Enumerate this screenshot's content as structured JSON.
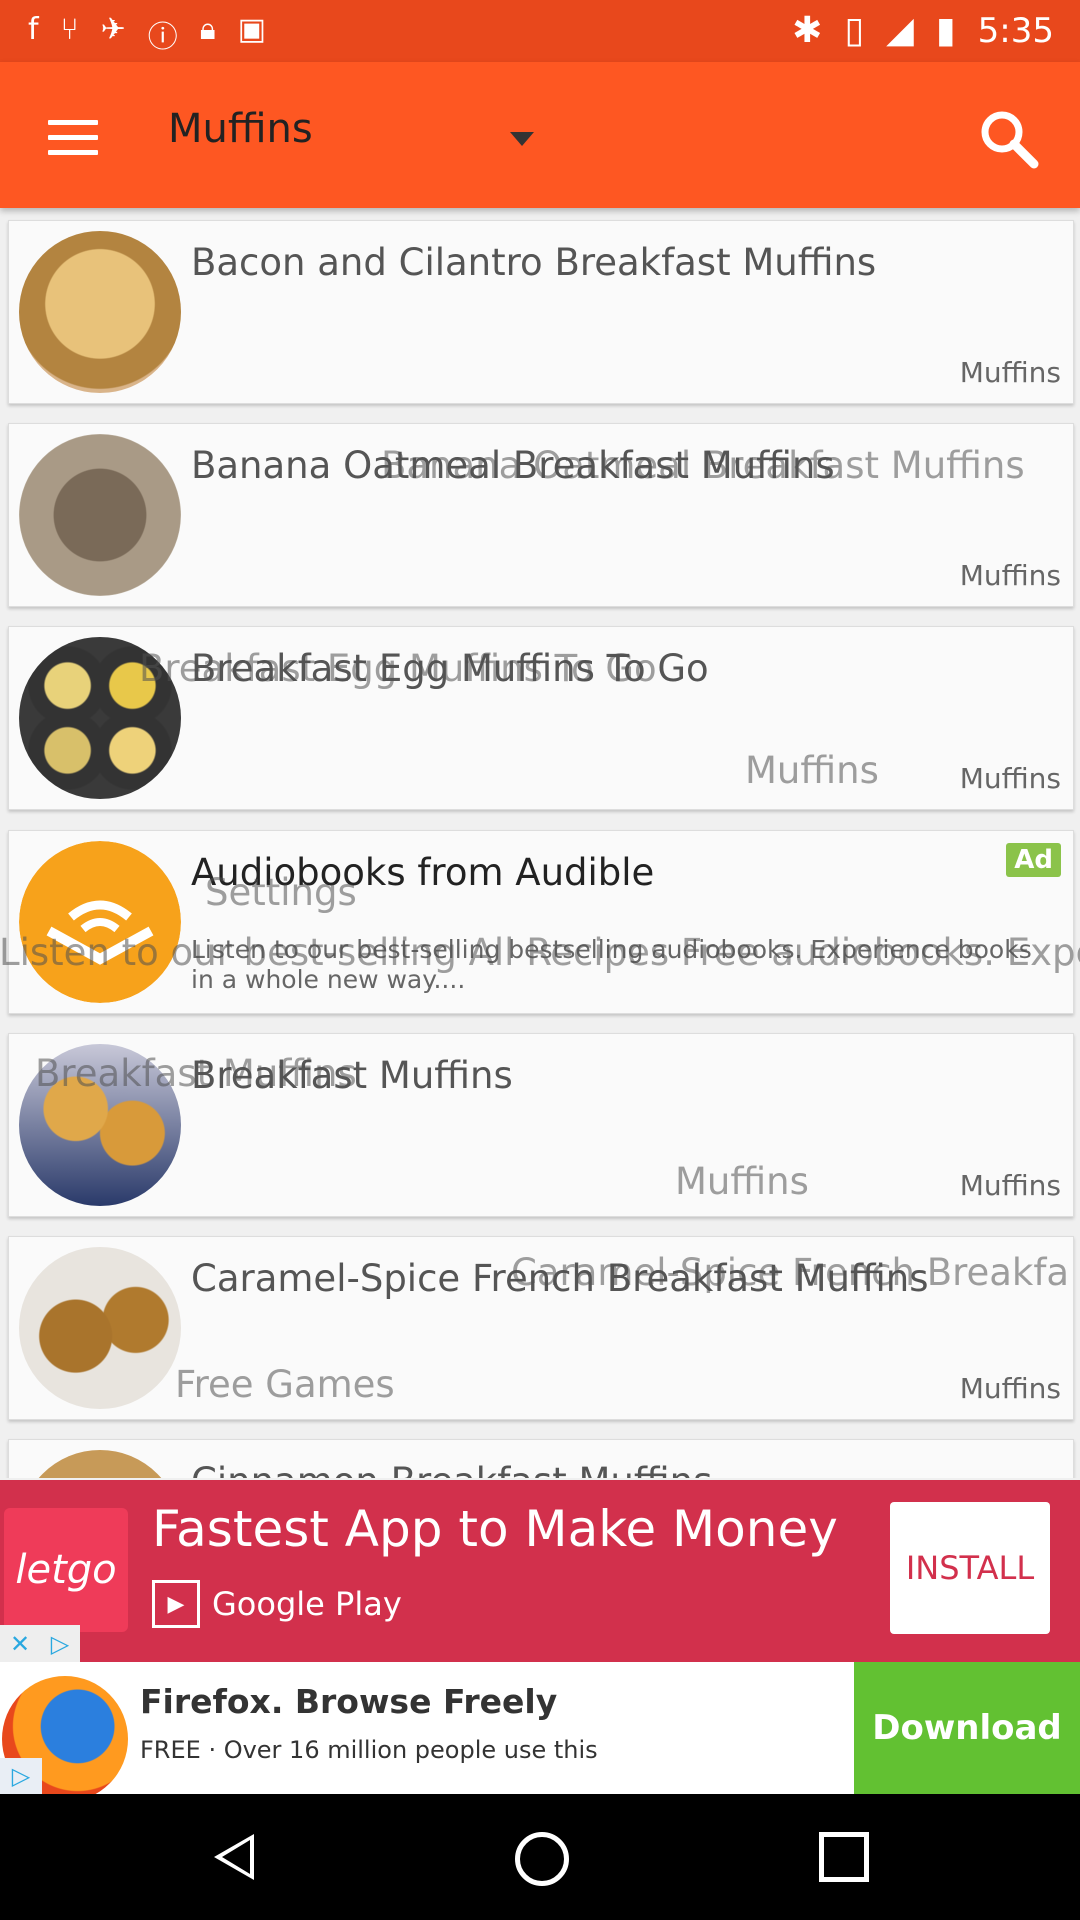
{
  "status_bar": {
    "time": "5:35",
    "icons": [
      "facebook-icon",
      "fork-icon",
      "satellite-icon",
      "alert-icon",
      "lock-icon",
      "android-icon"
    ],
    "right_icons": [
      "bluetooth-icon",
      "vibrate-icon",
      "signal-icon",
      "battery-icon"
    ]
  },
  "toolbar": {
    "title": "Muffins",
    "accent": "#fe5722"
  },
  "recipes": [
    {
      "title": "Bacon and Cilantro Breakfast Muffins",
      "category": "Muffins"
    },
    {
      "title": "Banana Oatmeal Breakfast Muffins",
      "category": "Muffins",
      "ghost": "Banana Oatmeal Breakfast Muffins"
    },
    {
      "title": "Breakfast Egg Muffins To Go",
      "category": "Muffins",
      "ghost": "Breakfast Egg Muffins To Go",
      "ghost2": "Muffins"
    },
    {
      "title": "Breakfast Muffins",
      "category": "Muffins",
      "ghost": "Breakfast Muffins",
      "ghost2": "Muffins"
    },
    {
      "title": "Caramel-Spice French Breakfast Muffins",
      "category": "Muffins",
      "ghost": "Caramel-Spice French Breakfa",
      "ghost2": "Free Games"
    },
    {
      "title": "Cinnamon Breakfast Muffins"
    }
  ],
  "ad_card": {
    "title": "Audiobooks from Audible",
    "badge": "Ad",
    "description": "Listen to our best-selling bestselling audiobooks. Experience books in a whole new way....",
    "ghost_settings": "Settings",
    "ghost_line": "Listen to our best-selling All Recipes Free audiobooks. Experie"
  },
  "banner_ad": {
    "brand": "letgo",
    "title": "Fastest App to Make Money",
    "store": "Google Play",
    "cta": "INSTALL"
  },
  "firefox_ad": {
    "title": "Firefox. Browse Freely",
    "subtitle": "FREE · Over 16 million people use this",
    "cta": "Download"
  }
}
